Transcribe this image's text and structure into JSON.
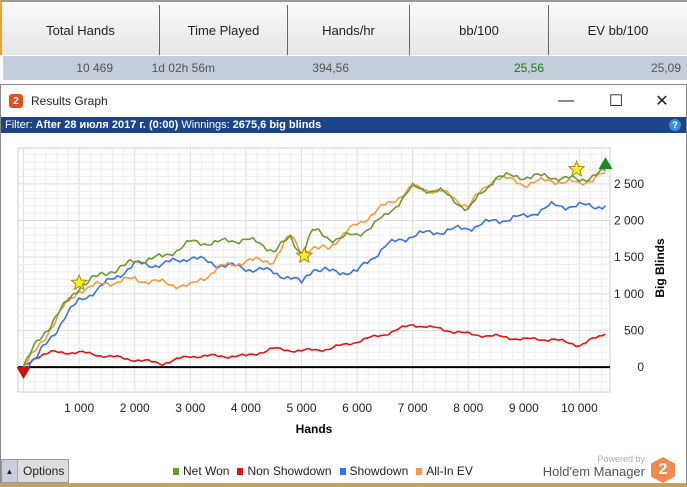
{
  "stats": {
    "headers": [
      "Total Hands",
      "Time Played",
      "Hands/hr",
      "bb/100",
      "EV bb/100"
    ],
    "values": [
      "10 469",
      "1d 02h 56m",
      "394,56",
      "25,56",
      "25,09"
    ],
    "bb100_color": "#1a7a1a"
  },
  "window": {
    "title": "Results Graph",
    "minimize": "—",
    "maximize": "☐",
    "close": "✕"
  },
  "filter": {
    "label": "Filter:",
    "value": "After 28 июля 2017 г. (0:00)",
    "winnings_label": "Winnings:",
    "winnings_value": "2675,6 big blinds",
    "help": "?"
  },
  "options_label": "Options",
  "powered_by": "Powered by",
  "brand": "Hold'em Manager",
  "brand_badge": "2",
  "chart_data": {
    "type": "line",
    "xlabel": "Hands",
    "ylabel": "Big Blinds",
    "xlim": [
      -100,
      10550
    ],
    "ylim": [
      -340,
      2990
    ],
    "grid": true,
    "legend": "bottom",
    "x_ticks": [
      1000,
      2000,
      3000,
      4000,
      5000,
      6000,
      7000,
      8000,
      9000,
      10000
    ],
    "x_tick_labels": [
      "1 000",
      "2 000",
      "3 000",
      "4 000",
      "5 000",
      "6 000",
      "7 000",
      "8 000",
      "9 000",
      "10 000"
    ],
    "y_ticks": [
      0,
      500,
      1000,
      1500,
      2000,
      2500
    ],
    "y_tick_labels": [
      "0",
      "500",
      "1 000",
      "1 500",
      "2 000",
      "2 500"
    ],
    "series": [
      {
        "name": "Net Won",
        "color": "#6a9a30",
        "x": [
          0,
          250,
          500,
          750,
          1000,
          1250,
          1500,
          1750,
          2000,
          2500,
          3000,
          3500,
          4000,
          4500,
          4800,
          5000,
          5200,
          5500,
          6000,
          6500,
          7000,
          7500,
          8000,
          8500,
          9000,
          9500,
          10000,
          10469
        ],
        "y": [
          0,
          350,
          600,
          850,
          1100,
          1200,
          1300,
          1350,
          1450,
          1500,
          1700,
          1700,
          1750,
          1600,
          1750,
          1550,
          1870,
          1750,
          1800,
          2050,
          2450,
          2400,
          2150,
          2600,
          2600,
          2600,
          2550,
          2675
        ]
      },
      {
        "name": "Non Showdown",
        "color": "#e81010",
        "x": [
          0,
          250,
          500,
          1000,
          1500,
          2000,
          2500,
          3000,
          3500,
          4000,
          4500,
          5000,
          5500,
          6000,
          6500,
          7000,
          7500,
          8000,
          8500,
          9000,
          9500,
          10000,
          10469
        ],
        "y": [
          0,
          150,
          200,
          200,
          150,
          100,
          50,
          150,
          150,
          150,
          250,
          220,
          250,
          350,
          450,
          580,
          520,
          450,
          420,
          380,
          380,
          300,
          450
        ]
      },
      {
        "name": "Showdown",
        "color": "#3a70f0",
        "x": [
          0,
          250,
          500,
          750,
          1000,
          1500,
          2000,
          2500,
          3000,
          3500,
          4000,
          4500,
          5000,
          5200,
          5500,
          6000,
          6500,
          7000,
          7500,
          8000,
          8500,
          9000,
          9500,
          10000,
          10469
        ],
        "y": [
          0,
          150,
          400,
          700,
          900,
          1150,
          1400,
          1400,
          1500,
          1400,
          1350,
          1300,
          1150,
          1350,
          1300,
          1300,
          1650,
          1800,
          1850,
          1900,
          2000,
          2050,
          2200,
          2200,
          2200
        ]
      },
      {
        "name": "All-In EV",
        "color": "#f59a40",
        "x": [
          0,
          250,
          500,
          750,
          1000,
          1500,
          2000,
          2500,
          3000,
          3500,
          4000,
          4500,
          4800,
          5000,
          5300,
          5500,
          6000,
          6500,
          7000,
          7500,
          8000,
          8500,
          9000,
          9500,
          10000,
          10469
        ],
        "y": [
          0,
          250,
          550,
          850,
          1050,
          1150,
          1200,
          1150,
          1100,
          1350,
          1450,
          1450,
          1800,
          1600,
          1600,
          1650,
          1950,
          2200,
          2450,
          2400,
          2200,
          2600,
          2500,
          2550,
          2500,
          2650
        ]
      }
    ],
    "annotations": [
      {
        "type": "star",
        "x": 1000,
        "y": 1150
      },
      {
        "type": "star",
        "x": 5050,
        "y": 1520
      },
      {
        "type": "star",
        "x": 9950,
        "y": 2700
      },
      {
        "type": "start-marker",
        "x": 0,
        "y": 0
      },
      {
        "type": "end-marker",
        "x": 10469,
        "y": 2675
      }
    ]
  }
}
